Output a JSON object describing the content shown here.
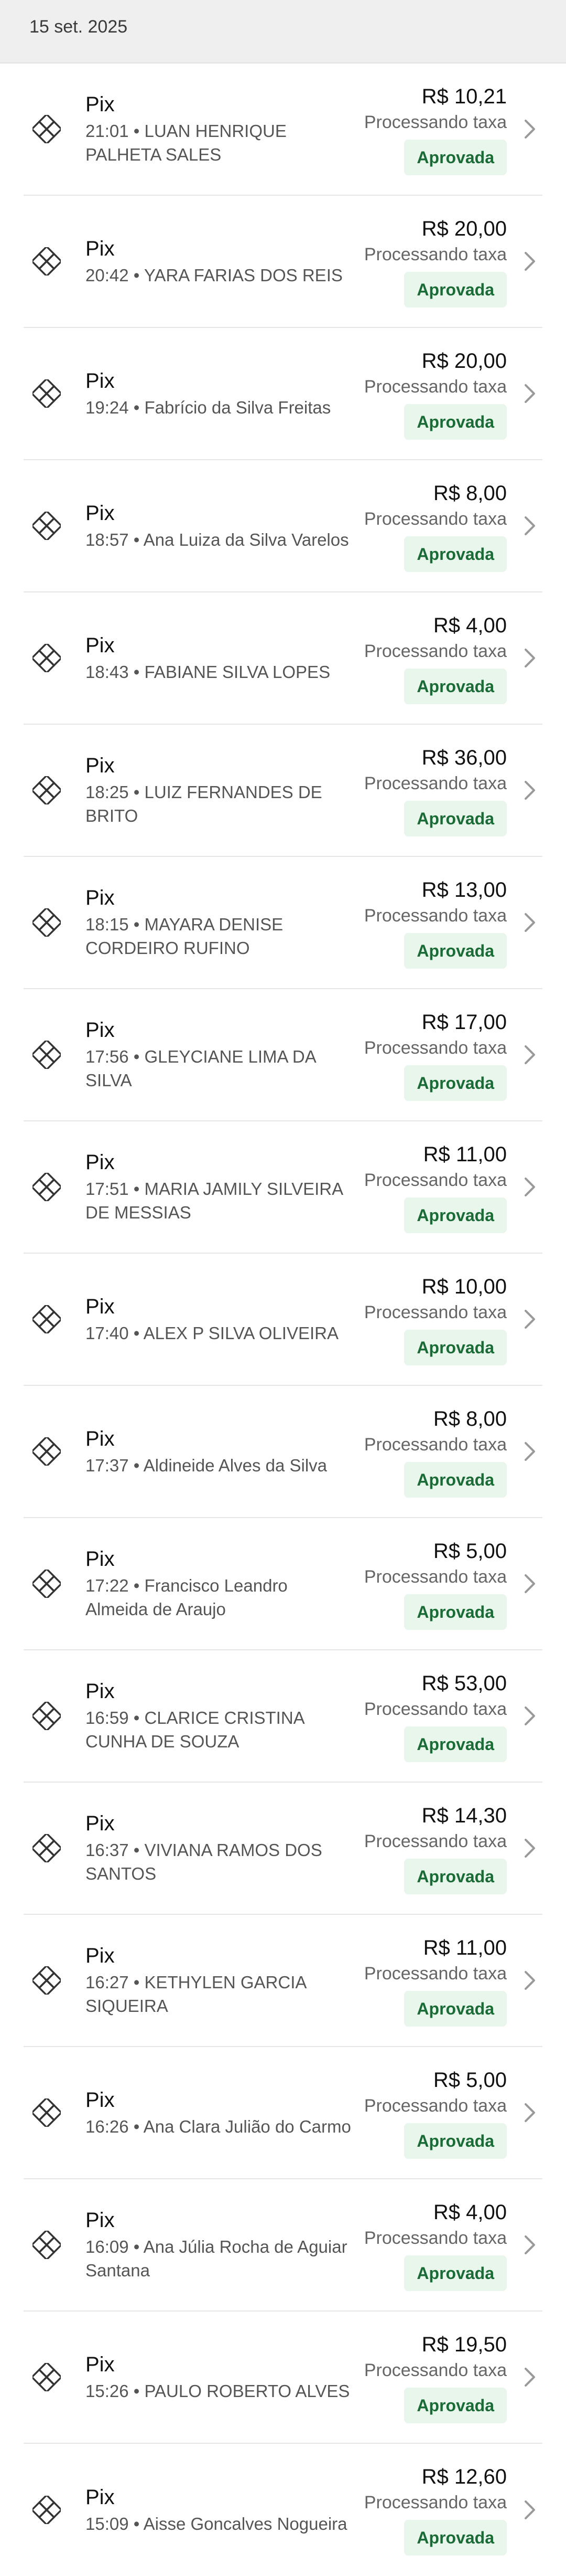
{
  "date_header": "15 set. 2025",
  "status_label": "Processando taxa",
  "badge_label": "Aprovada",
  "colors": {
    "badge_bg": "#e9f6ec",
    "badge_text": "#1b6b36"
  },
  "icons": {
    "row_icon": "pix-icon",
    "row_chevron": "chevron-right-icon"
  },
  "transactions": [
    {
      "method": "Pix",
      "time": "21:01",
      "name": "LUAN HENRIQUE PALHETA SALES",
      "amount": "R$ 10,21"
    },
    {
      "method": "Pix",
      "time": "20:42",
      "name": "YARA FARIAS DOS REIS",
      "amount": "R$ 20,00"
    },
    {
      "method": "Pix",
      "time": "19:24",
      "name": "Fabrício da Silva Freitas",
      "amount": "R$ 20,00"
    },
    {
      "method": "Pix",
      "time": "18:57",
      "name": "Ana Luiza da Silva Varelos",
      "amount": "R$ 8,00"
    },
    {
      "method": "Pix",
      "time": "18:43",
      "name": "FABIANE SILVA LOPES",
      "amount": "R$ 4,00"
    },
    {
      "method": "Pix",
      "time": "18:25",
      "name": "LUIZ FERNANDES DE BRITO",
      "amount": "R$ 36,00"
    },
    {
      "method": "Pix",
      "time": "18:15",
      "name": "MAYARA DENISE CORDEIRO RUFINO",
      "amount": "R$ 13,00"
    },
    {
      "method": "Pix",
      "time": "17:56",
      "name": "GLEYCIANE LIMA DA SILVA",
      "amount": "R$ 17,00"
    },
    {
      "method": "Pix",
      "time": "17:51",
      "name": "MARIA JAMILY SILVEIRA DE MESSIAS",
      "amount": "R$ 11,00"
    },
    {
      "method": "Pix",
      "time": "17:40",
      "name": "ALEX P SILVA OLIVEIRA",
      "amount": "R$ 10,00"
    },
    {
      "method": "Pix",
      "time": "17:37",
      "name": "Aldineide Alves da Silva",
      "amount": "R$ 8,00"
    },
    {
      "method": "Pix",
      "time": "17:22",
      "name": "Francisco Leandro Almeida de Araujo",
      "amount": "R$ 5,00"
    },
    {
      "method": "Pix",
      "time": "16:59",
      "name": "CLARICE CRISTINA CUNHA DE SOUZA",
      "amount": "R$ 53,00"
    },
    {
      "method": "Pix",
      "time": "16:37",
      "name": "VIVIANA RAMOS DOS SANTOS",
      "amount": "R$ 14,30"
    },
    {
      "method": "Pix",
      "time": "16:27",
      "name": "KETHYLEN GARCIA SIQUEIRA",
      "amount": "R$ 11,00"
    },
    {
      "method": "Pix",
      "time": "16:26",
      "name": "Ana Clara Julião do Carmo",
      "amount": "R$ 5,00"
    },
    {
      "method": "Pix",
      "time": "16:09",
      "name": "Ana Júlia Rocha de Aguiar Santana",
      "amount": "R$ 4,00"
    },
    {
      "method": "Pix",
      "time": "15:26",
      "name": "PAULO ROBERTO ALVES",
      "amount": "R$ 19,50"
    },
    {
      "method": "Pix",
      "time": "15:09",
      "name": "Aisse Goncalves Nogueira",
      "amount": "R$ 12,60"
    }
  ]
}
